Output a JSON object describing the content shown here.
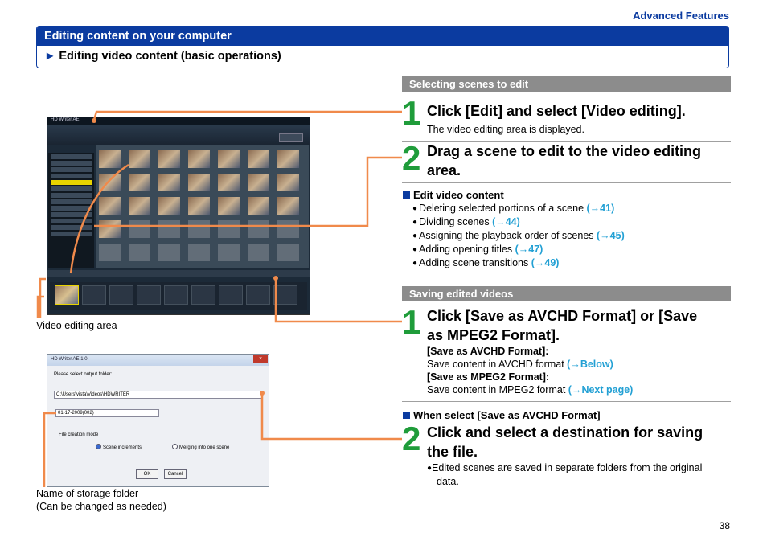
{
  "header": {
    "section_tag": "Advanced Features",
    "title": "Editing content on your computer",
    "subtitle_marker": "►",
    "subtitle": "Editing video content (basic operations)"
  },
  "section1": {
    "bar": "Selecting scenes to edit",
    "step1": {
      "num": "1",
      "title": "Click [Edit] and select [Video editing].",
      "text": "The video editing area is displayed."
    },
    "step2": {
      "num": "2",
      "title_line1": "Drag a scene to edit to the video editing",
      "title_line2": "area."
    },
    "edit_video_content": {
      "heading": "Edit video content",
      "items": [
        {
          "text": "Deleting selected portions of a scene ",
          "link": "(→41)"
        },
        {
          "text": "Dividing scenes ",
          "link": "(→44)"
        },
        {
          "text": "Assigning the playback order of scenes ",
          "link": "(→45)"
        },
        {
          "text": "Adding opening titles ",
          "link": "(→47)"
        },
        {
          "text": "Adding scene transitions ",
          "link": "(→49)"
        }
      ]
    }
  },
  "section2": {
    "bar": "Saving edited videos",
    "step1": {
      "num": "1",
      "title_line1": "Click [Save as AVCHD Format] or [Save",
      "title_line2": "as MPEG2 Format].",
      "avchd_label": "[Save as AVCHD Format]:",
      "avchd_text": "Save content in AVCHD format ",
      "avchd_link": "(→Below)",
      "mpeg2_label": "[Save as MPEG2 Format]:",
      "mpeg2_text": "Save content in MPEG2 format ",
      "mpeg2_link": "(→Next page)"
    },
    "when_select": "When select [Save as AVCHD Format]",
    "step2": {
      "num": "2",
      "title_line1": "Click and select a destination for saving",
      "title_line2": "the file.",
      "bullet_line1": "Edited scenes are saved in separate folders from the original",
      "bullet_line2": "data."
    }
  },
  "captions": {
    "video_editing_area": "Video editing area",
    "storage_folder_line1": "Name of storage folder",
    "storage_folder_line2": "(Can be changed as needed)"
  },
  "screenshot1": {
    "title": "HD Writer AE",
    "toolbar_labels": [
      "Import to PC",
      "Play",
      "Create Media",
      "Network",
      "Capture",
      "Search",
      "Delete"
    ],
    "edit_button": "Edit",
    "tree_items": [
      "PC Hard drive(HD)",
      "C:\\Users\\vista\\Vid...",
      "01-15-2009",
      "01-16-2009",
      "01-17-2009",
      "C:\\Users\\vista\\Pic...",
      "C:\\Users\\Public\\Vi...",
      "C:\\Users\\Public\\Pi...",
      "PC Hard drive",
      "BD/DVD"
    ],
    "video_editing": "Video editing"
  },
  "screenshot2": {
    "title": "HD Writer AE 1.0",
    "prompt": "Please select output folder:",
    "path": "C:\\Users\\vista\\Videos\\HDWRITER",
    "folder_name": "01-17-2009(002)",
    "mode_label": "File creation mode",
    "option1": "Scene increments",
    "option2": "Merging into one scene",
    "ok": "OK",
    "cancel": "Cancel"
  },
  "page_number": "38",
  "colors": {
    "brand_blue": "#0b3ba0",
    "step_green": "#1f9c3a",
    "link_cyan": "#22a0d4",
    "callout_orange": "#f08a4b",
    "bar_gray": "#8c8c8c"
  }
}
